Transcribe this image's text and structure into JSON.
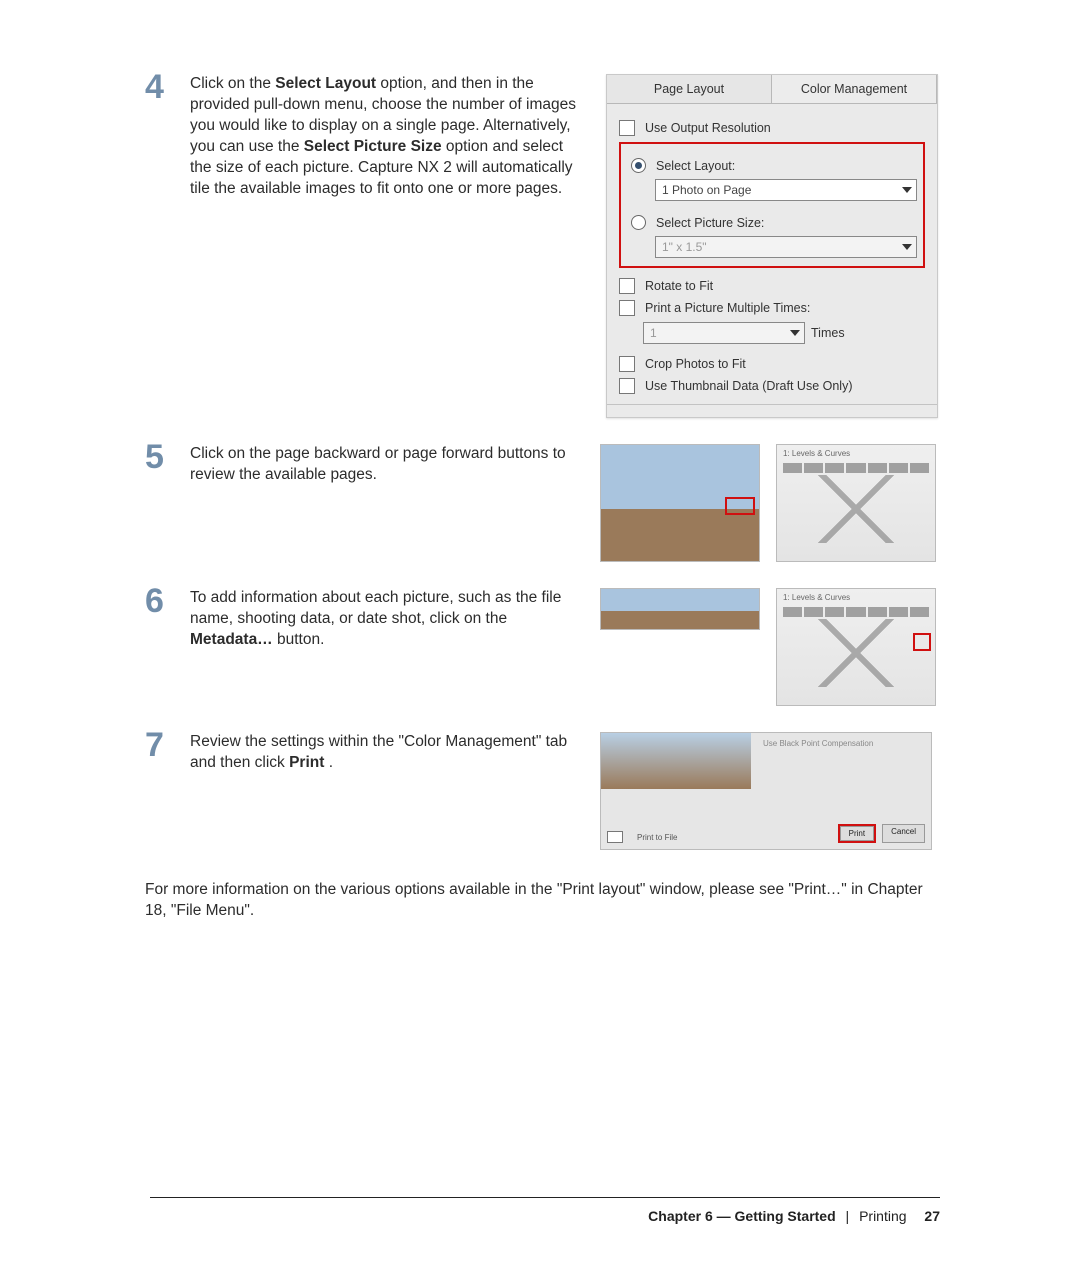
{
  "steps": {
    "s4": {
      "num": "4",
      "text_pre": "Click on the ",
      "b1": "Select Layout",
      "text_mid1": " option, and then in the provided pull-down menu, choose the number of images you would like to display on a single page. Alternatively, you can use the ",
      "b2": "Select Picture Size",
      "text_mid2": " option and select the size of each picture. Capture NX 2 will automatically tile the available images to fit onto one or more pages."
    },
    "s5": {
      "num": "5",
      "text": "Click on the page backward or page forward buttons to review the available pages."
    },
    "s6": {
      "num": "6",
      "text_pre": "To add information about each picture, such as the file name, shooting data, or date shot, click on the ",
      "b1": "Metadata…",
      "text_post": " button."
    },
    "s7": {
      "num": "7",
      "text_pre": "Review the settings within the \"Color Management\" tab and then click ",
      "b1": "Print",
      "text_post": "."
    }
  },
  "panel": {
    "tab_page_layout": "Page Layout",
    "tab_color_mgmt": "Color Management",
    "use_output_res": "Use Output Resolution",
    "select_layout_label": "Select Layout:",
    "select_layout_value": "1 Photo on Page",
    "select_picture_size_label": "Select Picture Size:",
    "select_picture_size_value": "1\" x 1.5\"",
    "rotate_to_fit": "Rotate to Fit",
    "print_multiple": "Print a Picture Multiple Times:",
    "times_value": "1",
    "times_label": "Times",
    "crop_to_fit": "Crop Photos to Fit",
    "use_thumb": "Use Thumbnail Data (Draft Use Only)"
  },
  "shots": {
    "levels_title": "1: Levels & Curves",
    "print_to_file": "Print to File",
    "btn_print": "Print",
    "btn_cancel": "Cancel",
    "cm_label": "Use Black Point Compensation"
  },
  "closing_text": "For more information on the various options available in the \"Print layout\" window, please see \"Print…\" in Chapter 18, \"File Menu\".",
  "footer": {
    "chapter": "Chapter 6 — Getting Started",
    "section": "Printing",
    "page": "27"
  }
}
